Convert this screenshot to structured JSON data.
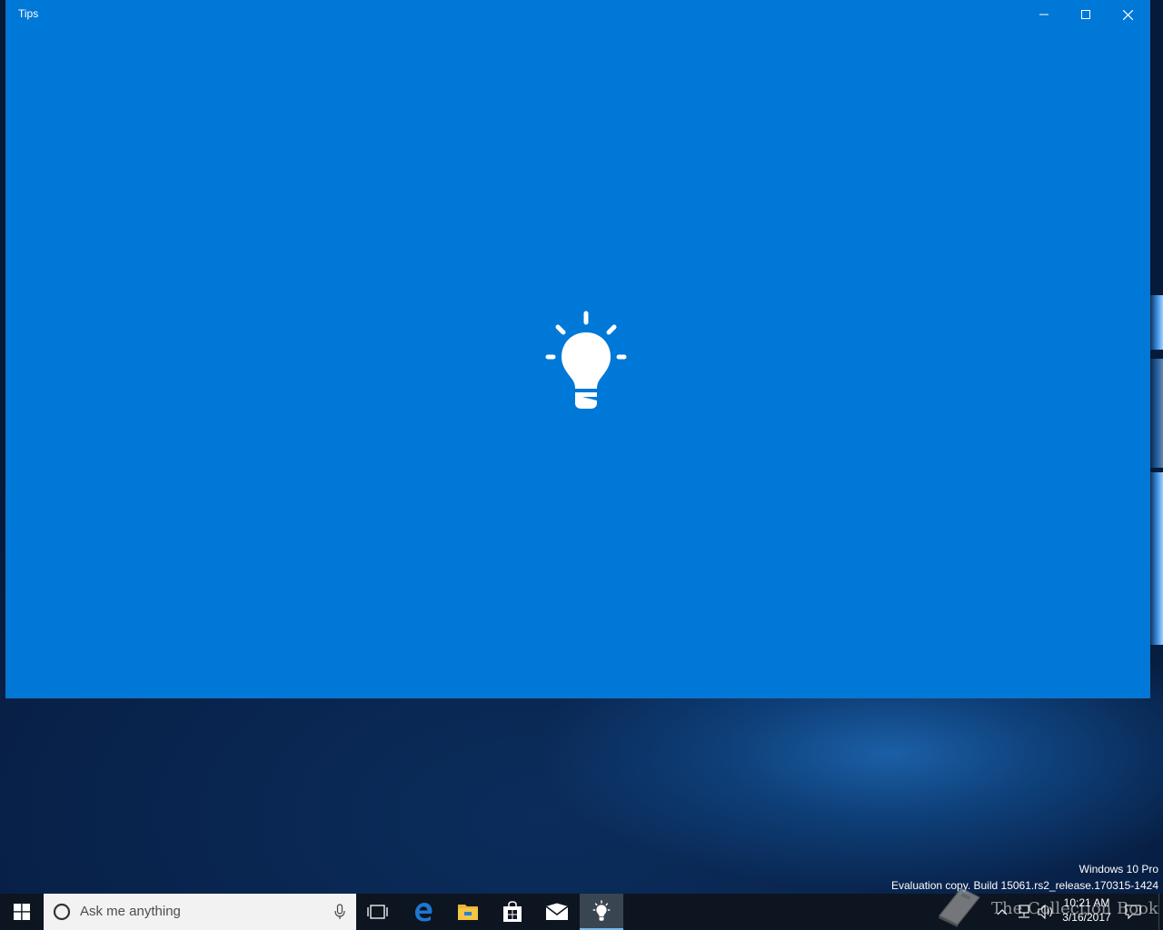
{
  "window": {
    "title": "Tips",
    "background_color": "#0078d7",
    "splash_icon": "lightbulb-icon",
    "caption_buttons": [
      "minimize-icon",
      "maximize-icon",
      "close-icon"
    ]
  },
  "desktop_watermark": {
    "edition": "Windows 10 Pro",
    "build": "Evaluation copy. Build 15061.rs2_release.170315-1424",
    "overlay_text": "The Collection Book"
  },
  "taskbar": {
    "search_placeholder": "Ask me anything",
    "pinned_apps": [
      {
        "name": "task-view",
        "icon": "task-view-icon"
      },
      {
        "name": "edge",
        "icon": "edge-icon",
        "color": "#1f76d1"
      },
      {
        "name": "file-explorer",
        "icon": "folder-icon",
        "color": "#f5c543"
      },
      {
        "name": "store",
        "icon": "store-icon"
      },
      {
        "name": "mail",
        "icon": "mail-icon"
      },
      {
        "name": "tips",
        "icon": "lightbulb-icon",
        "active": true
      }
    ],
    "tray_icons": [
      "chevron-up-icon",
      "network-icon",
      "volume-icon",
      "action-center-icon"
    ],
    "clock": {
      "time": "10:21 AM",
      "date": "3/16/2017"
    }
  }
}
